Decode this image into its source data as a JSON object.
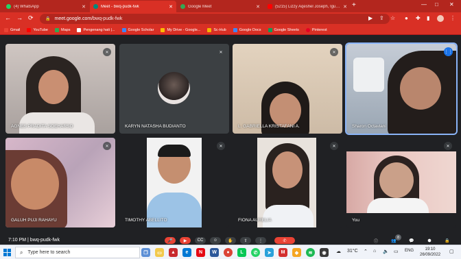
{
  "browser": {
    "tabs": [
      {
        "label": "(4) WhatsApp",
        "color": "#25d366"
      },
      {
        "label": "Meet - bwq-pudk-fwk",
        "color": "#00897b"
      },
      {
        "label": "Google Meet",
        "color": "#34a853"
      },
      {
        "label": "(5215) Lizzy Aqeshel Joseph, Igung...",
        "color": "#ff0000"
      }
    ],
    "new_tab": "+",
    "window_controls": [
      "—",
      "□",
      "✕"
    ],
    "url_host": "meet.google.com",
    "url_path": "/bwq-pudk-fwk",
    "bookmarks": [
      {
        "label": "Gmail",
        "color": "#ea4335"
      },
      {
        "label": "YouTube",
        "color": "#ff0000"
      },
      {
        "label": "Maps",
        "color": "#34a853"
      },
      {
        "label": "Pengenang hati |...",
        "color": "#ffffff"
      },
      {
        "label": "Google Scholar",
        "color": "#4285f4"
      },
      {
        "label": "My Drive - Google...",
        "color": "#fbbc04"
      },
      {
        "label": "Sc-Hub",
        "color": "#f4b400"
      },
      {
        "label": "Google Docs",
        "color": "#4285f4"
      },
      {
        "label": "Google Sheets",
        "color": "#0f9d58"
      },
      {
        "label": "Pinterest",
        "color": "#e60023"
      }
    ]
  },
  "meet": {
    "participants": [
      {
        "name": "AGNES PRADITA SOEHARSO",
        "muted": true,
        "speaking": false
      },
      {
        "name": "KARYN NATASHA BUDIANTO",
        "muted": true,
        "speaking": false
      },
      {
        "name": "L. GABRIELLA KRISTAFANI A.",
        "muted": true,
        "speaking": false
      },
      {
        "name": "Sharon Octaviani",
        "muted": false,
        "speaking": true
      },
      {
        "name": "GALUH PUJI RAHAYU",
        "muted": true,
        "speaking": false
      },
      {
        "name": "TIMOTHY ABELLITO",
        "muted": true,
        "speaking": false
      },
      {
        "name": "FIONA AURELIA",
        "muted": true,
        "speaking": false
      },
      {
        "name": "You",
        "muted": true,
        "speaking": false
      }
    ],
    "time": "7:10 PM",
    "meeting_code": "bwq-pudk-fwk",
    "participant_count": "8"
  },
  "taskbar": {
    "search_placeholder": "Type here to search",
    "weather": "31°C",
    "language": "ENG",
    "time": "19:10",
    "date": "26/09/2022"
  }
}
